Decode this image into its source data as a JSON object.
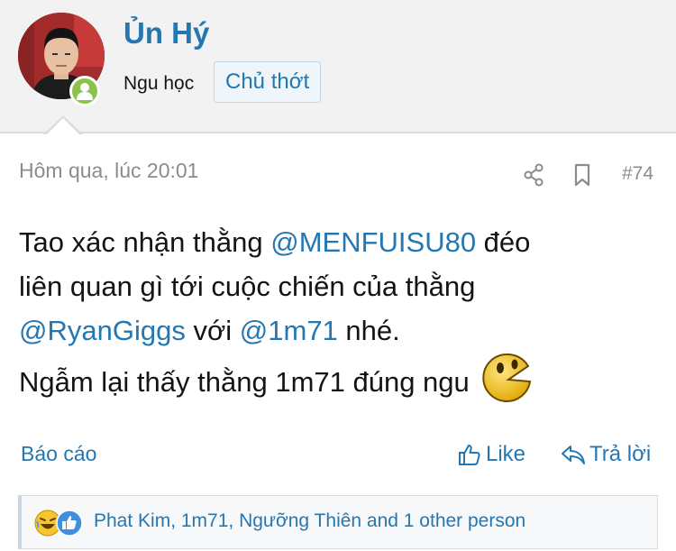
{
  "user": {
    "name": "Ủn Hý",
    "title": "Ngu học",
    "banner": "Chủ thớt",
    "status_color": "#8bc34a"
  },
  "post": {
    "date": "Hôm qua, lúc 20:01",
    "number": "#74",
    "message": {
      "l1_text": "Tao xác nhận thằng ",
      "l1_mention": "@MENFUISU80",
      "l1_tail": " đéo",
      "l2_text": "liên quan gì tới cuộc chiến của thằng",
      "l3_mention1": "@RyanGiggs",
      "l3_text": " với ",
      "l3_mention2": "@1m71",
      "l3_tail": " nhé.",
      "l4_text": "Ngẫm lại thấy thằng 1m71 đúng ngu",
      "smilie": "pacman-smilie"
    }
  },
  "actions": {
    "report": "Báo cáo",
    "like": "Like",
    "reply": "Trả lời"
  },
  "reactions": {
    "icons": [
      "laugh-reaction-icon",
      "like-reaction-icon"
    ],
    "text": "Phat Kim, 1m71, Ngưỡng Thiên and 1 other person"
  },
  "colors": {
    "link": "#2577b1",
    "muted": "#8c8c8c",
    "header_bg": "#f2f2f2"
  }
}
